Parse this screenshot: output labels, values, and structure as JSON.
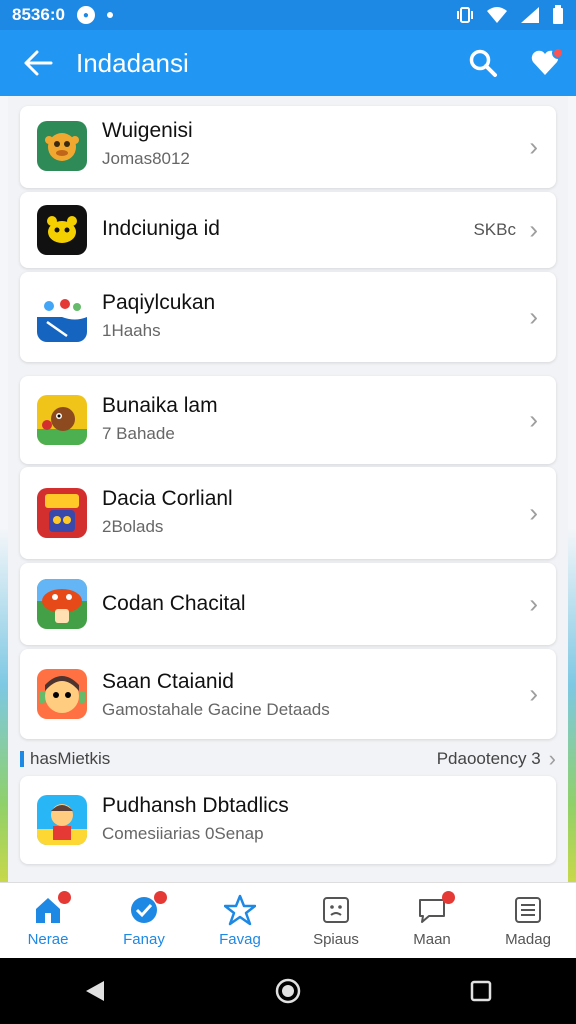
{
  "status_bar": {
    "time": "8536:0",
    "colors": {
      "bg": "#1e88e5"
    }
  },
  "app_bar": {
    "title": "Indadansi",
    "back_icon": "arrow-left-icon",
    "search_icon": "search-icon",
    "heart_icon": "heart-icon"
  },
  "list": [
    {
      "title": "Wuigenisi",
      "subtitle": "Jomas8012",
      "meta": "",
      "icon": "monkey-icon",
      "icon_bg": "#2e8b57"
    },
    {
      "title": "Indciuniga id",
      "subtitle": "",
      "meta": "SKBc",
      "icon": "bear-icon",
      "icon_bg": "#111111"
    },
    {
      "title": "Paqiylcukan",
      "subtitle": "1Haahs",
      "meta": "",
      "icon": "water-icon",
      "icon_bg": "#ffffff"
    },
    {
      "title": "Bunaika lam",
      "subtitle": "7 Bahade",
      "meta": "",
      "icon": "critter-icon",
      "icon_bg": "#f0c419"
    },
    {
      "title": "Dacia Corlianl",
      "subtitle": "2Bolads",
      "meta": "",
      "icon": "robot-icon",
      "icon_bg": "#d32f2f"
    },
    {
      "title": "Codan Chacital",
      "subtitle": "",
      "meta": "",
      "icon": "mushroom-icon",
      "icon_bg": "#43a047"
    },
    {
      "title": "Saan Ctaianid",
      "subtitle": "Gamostahale Gacine Detaads",
      "meta": "",
      "icon": "face-icon",
      "icon_bg": "#ff7043"
    }
  ],
  "section": {
    "label": "hasMietkis",
    "right_text": "Pdaootency 3"
  },
  "extra_item": {
    "title": "Pudhansh Dbtadlics",
    "subtitle": "Comesiiarias 0Senap",
    "icon": "kid-icon",
    "icon_bg": "#29b6f6"
  },
  "bottom_nav": [
    {
      "label": "Nerae",
      "icon": "home-icon",
      "badge": true,
      "active": true
    },
    {
      "label": "Fanay",
      "icon": "check-circle-icon",
      "badge": true,
      "active": true
    },
    {
      "label": "Favag",
      "icon": "star-icon",
      "badge": false,
      "active": true
    },
    {
      "label": "Spiaus",
      "icon": "grid-icon",
      "badge": false,
      "active": false
    },
    {
      "label": "Maan",
      "icon": "chat-icon",
      "badge": true,
      "active": false
    },
    {
      "label": "Madag",
      "icon": "document-icon",
      "badge": false,
      "active": false
    }
  ],
  "system_nav": {
    "back": "back-triangle-icon",
    "home": "home-circle-icon",
    "recents": "recents-square-icon"
  }
}
